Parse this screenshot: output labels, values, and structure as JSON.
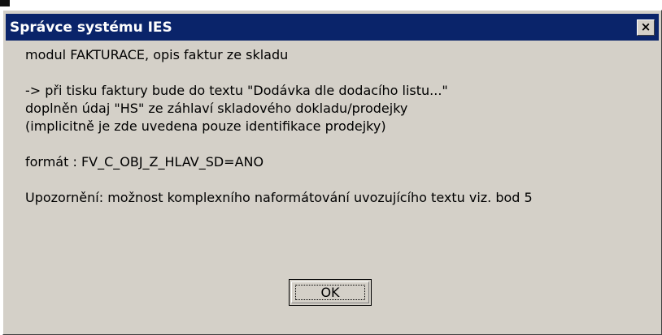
{
  "dialog": {
    "title": "Správce systému IES",
    "close_label": "×",
    "paragraphs": {
      "p1": [
        "modul FAKTURACE, opis faktur ze skladu"
      ],
      "p2": [
        "-> při tisku faktury bude do textu \"Dodávka dle dodacího listu...\"",
        "doplněn údaj \"HS\" ze záhlaví skladového dokladu/prodejky",
        "(implicitně je zde uvedena pouze identifikace prodejky)"
      ],
      "p3": [
        "formát : FV_C_OBJ_Z_HLAV_SD=ANO"
      ],
      "p4": [
        "Upozornění: možnost komplexního naformátování uvozujícího textu viz. bod 5"
      ]
    },
    "ok_label": "OK"
  },
  "colors": {
    "titlebar": "#0a246a",
    "dialog_bg": "#d4d0c8",
    "title_text": "#ffffff"
  }
}
